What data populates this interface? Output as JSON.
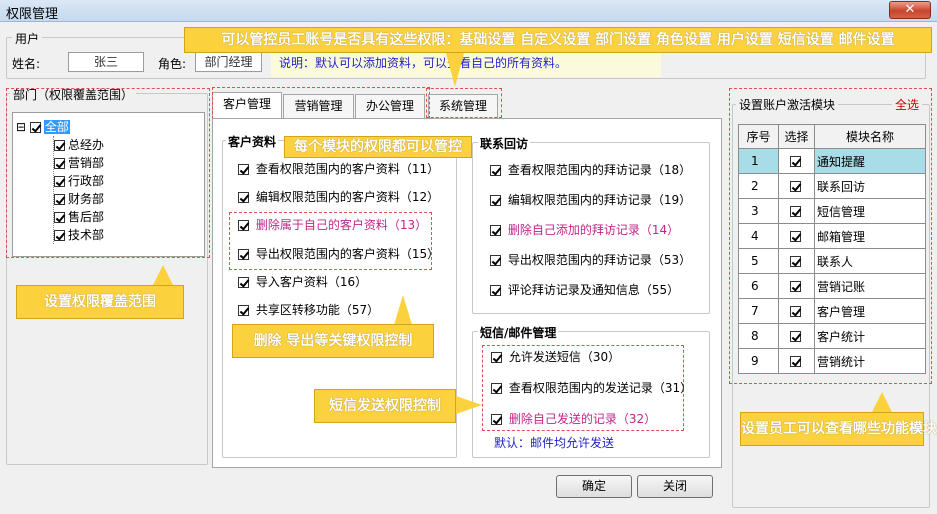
{
  "window": {
    "title": "权限管理",
    "close": "✕"
  },
  "user": {
    "group_label": "用户",
    "name_label": "姓名:",
    "name_value": "张三",
    "role_label": "角色:",
    "role_value": "部门经理",
    "note_part1": "说明：默认可以添加资料，",
    "note_part2": "可以查看自己的所有资料。"
  },
  "callouts": {
    "top": "可以管控员工账号是否具有这些权限：基础设置 自定义设置 部门设置 角色设置 用户设置 短信设置 邮件设置",
    "modules": "每个模块的权限都可以管控",
    "scope": "设置权限覆盖范围",
    "key_perms": "删除 导出等关键权限控制",
    "sms": "短信发送权限控制",
    "func_modules": "设置员工可以查看哪些功能模块"
  },
  "department": {
    "group_label": "部门（权限覆盖范围）",
    "expander": "⊟",
    "root": "全部",
    "items": [
      "总经办",
      "营销部",
      "行政部",
      "财务部",
      "售后部",
      "技术部"
    ]
  },
  "tabs": [
    "客户管理",
    "营销管理",
    "办公管理",
    "系统管理"
  ],
  "customer": {
    "title": "客户资料",
    "items": [
      {
        "text": "查看权限范围内的客户资料（11）"
      },
      {
        "text": "编辑权限范围内的客户资料（12）"
      },
      {
        "text": "删除属于自己的客户资料（13）"
      },
      {
        "text": "导出权限范围内的客户资料（15）"
      },
      {
        "text": "导入客户资料（16）"
      },
      {
        "text": "共享区转移功能（57）"
      }
    ]
  },
  "visit": {
    "title": "联系回访",
    "items": [
      {
        "text": "查看权限范围内的拜访记录（18）"
      },
      {
        "text": "编辑权限范围内的拜访记录（19）"
      },
      {
        "text": "删除自己添加的拜访记录（14）"
      },
      {
        "text": "导出权限范围内的拜访记录（53）"
      },
      {
        "text": "评论拜访记录及通知信息（55）"
      }
    ]
  },
  "sms": {
    "title": "短信/邮件管理",
    "items": [
      {
        "text": "允许发送短信（30）"
      },
      {
        "text": "查看权限范围内的发送记录（31）"
      },
      {
        "text": "删除自己发送的记录（32）"
      }
    ],
    "default_note": "默认：邮件均允许发送"
  },
  "buttons": {
    "ok": "确定",
    "close": "关闭"
  },
  "module_panel": {
    "title": "设置账户激活模块",
    "select_all": "全选",
    "headers": [
      "序号",
      "选择",
      "模块名称"
    ],
    "rows": [
      {
        "no": "1",
        "name": "通知提醒"
      },
      {
        "no": "2",
        "name": "联系回访"
      },
      {
        "no": "3",
        "name": "短信管理"
      },
      {
        "no": "4",
        "name": "邮箱管理"
      },
      {
        "no": "5",
        "name": "联系人"
      },
      {
        "no": "6",
        "name": "营销记账"
      },
      {
        "no": "7",
        "name": "客户管理"
      },
      {
        "no": "8",
        "name": "客户统计"
      },
      {
        "no": "9",
        "name": "营销统计"
      }
    ]
  },
  "colors": {
    "callout": "#fbd23e",
    "highlight_text": "#c0268a",
    "link_text": "#1f1fc8",
    "select_all": "#cc0000",
    "row_selected": "#a8dce6"
  }
}
